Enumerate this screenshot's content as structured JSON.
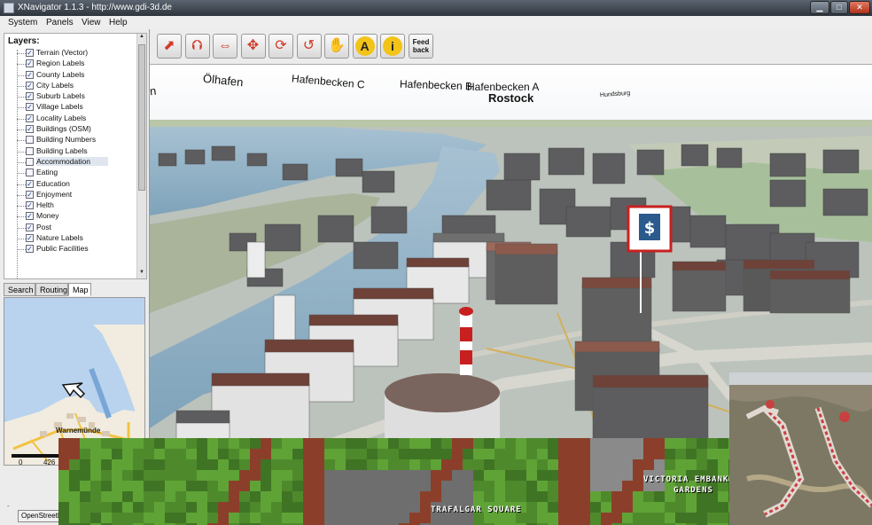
{
  "window": {
    "title": "XNavigator 1.1.3 - http://www.gdi-3d.de",
    "minimize_glyph": "▁",
    "maximize_glyph": "□",
    "close_glyph": "✕"
  },
  "menu": [
    "System",
    "Panels",
    "View",
    "Help"
  ],
  "layers": {
    "title": "Layers:",
    "items": [
      {
        "label": "Terrain (Vector)",
        "checked": true
      },
      {
        "label": "Region Labels",
        "checked": true
      },
      {
        "label": "County Labels",
        "checked": true
      },
      {
        "label": "City Labels",
        "checked": true
      },
      {
        "label": "Suburb Labels",
        "checked": true
      },
      {
        "label": "Village Labels",
        "checked": true
      },
      {
        "label": "Locality Labels",
        "checked": true
      },
      {
        "label": "Buildings (OSM)",
        "checked": true
      },
      {
        "label": "Building Numbers",
        "checked": false
      },
      {
        "label": "Building Labels",
        "checked": false
      },
      {
        "label": "Accommodation",
        "checked": false,
        "selected": true
      },
      {
        "label": "Eating",
        "checked": false
      },
      {
        "label": "Education",
        "checked": true
      },
      {
        "label": "Enjoyment",
        "checked": true
      },
      {
        "label": "Helth",
        "checked": true
      },
      {
        "label": "Money",
        "checked": true
      },
      {
        "label": "Post",
        "checked": true
      },
      {
        "label": "Nature Labels",
        "checked": true
      },
      {
        "label": "Public Facilities",
        "checked": true
      }
    ]
  },
  "tabs": [
    {
      "label": "Search",
      "active": false
    },
    {
      "label": "Routing",
      "active": false
    },
    {
      "label": "Map",
      "active": true
    }
  ],
  "minimap": {
    "place_label": "Warnemünde",
    "scale_start": "0",
    "scale_end": "426",
    "credit_button": "OpenStreetMap",
    "dash": "-"
  },
  "toolbar": {
    "tools": [
      {
        "name": "rotate-up-tool",
        "glyph": "⬈"
      },
      {
        "name": "tilt-tool",
        "glyph": "⮉"
      },
      {
        "name": "move-horizontal-tool",
        "glyph": "⇔"
      },
      {
        "name": "move-cross-tool",
        "glyph": "✥"
      },
      {
        "name": "rotate-tool",
        "glyph": "⟳"
      },
      {
        "name": "turn-tool",
        "glyph": "↺"
      },
      {
        "name": "pan-hand-tool",
        "glyph": "✋"
      },
      {
        "name": "label-tool",
        "glyph": "A"
      },
      {
        "name": "info-tool",
        "glyph": "i"
      }
    ],
    "feedback_line1": "Feed",
    "feedback_line2": "back"
  },
  "scene_labels": [
    {
      "text": "n",
      "size": 13
    },
    {
      "text": "Ölhafen",
      "size": 13
    },
    {
      "text": "Hafenbecken C",
      "size": 12
    },
    {
      "text": "Hafenbecken B",
      "size": 12
    },
    {
      "text": "Hafenbecken A",
      "size": 12
    },
    {
      "text": "Rostock",
      "size": 13
    },
    {
      "text": "Hundsburg",
      "size": 7
    }
  ],
  "game_overlay": {
    "label1": "TRAFALGAR SQUARE",
    "label2_line1": "VICTORIA EMBANKM",
    "label2_line2": "GARDENS"
  },
  "colors": {
    "water": "#8fb2c8",
    "ground": "#bcc3bc",
    "roof": "#6e4238",
    "building": "#5d5d5f",
    "lighthouse_red": "#c82020"
  }
}
